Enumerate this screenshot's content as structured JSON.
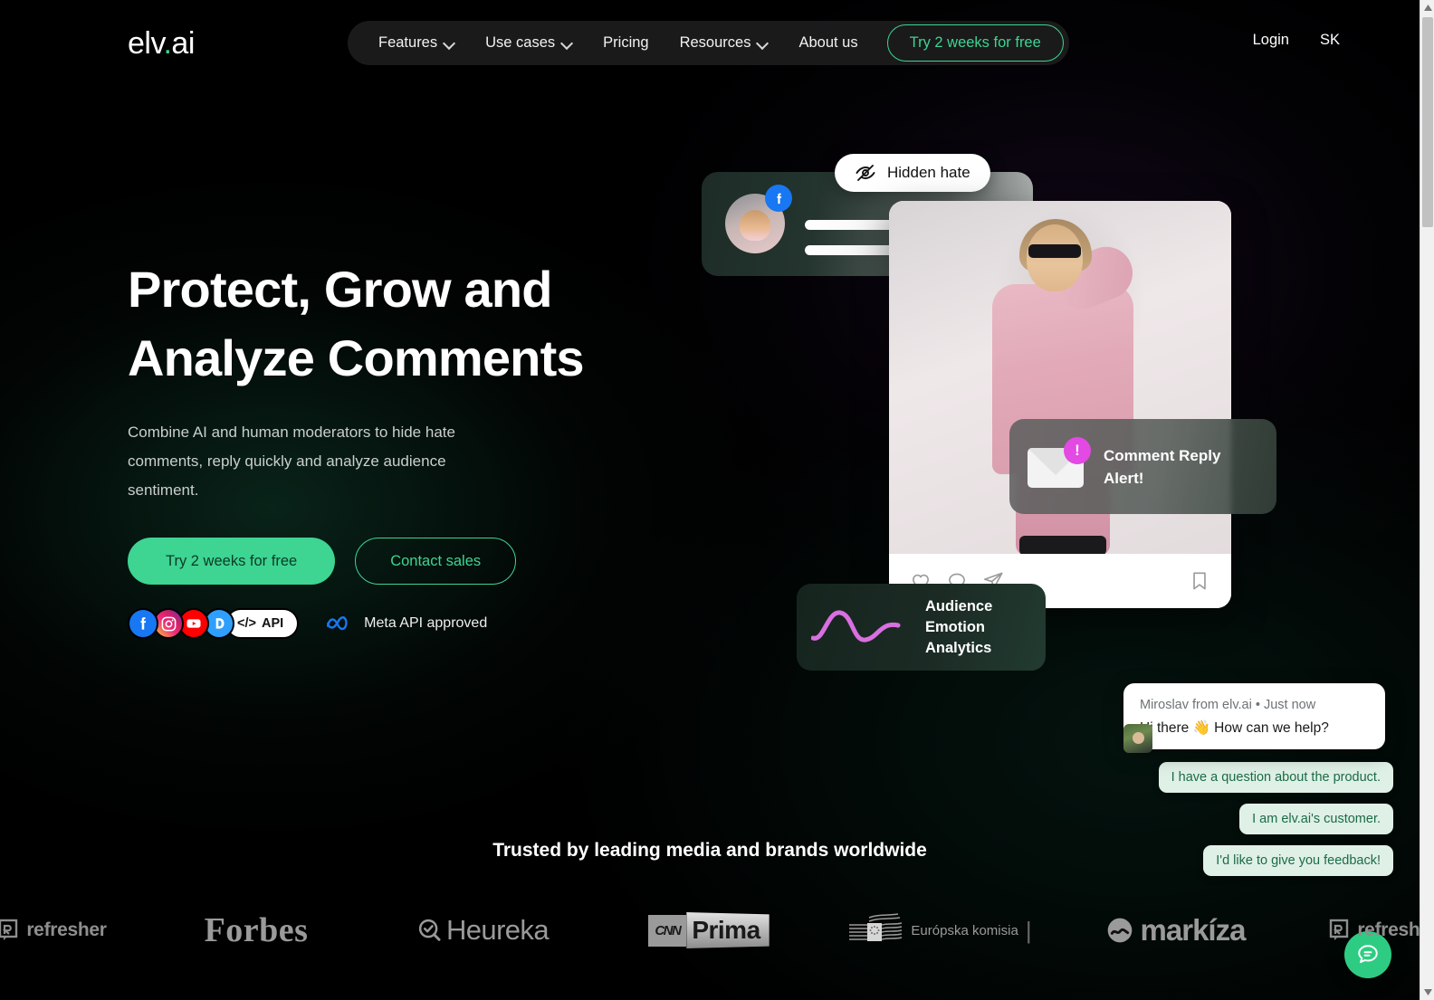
{
  "header": {
    "logo_text": "elv",
    "logo_dot": ".",
    "logo_suffix": "ai",
    "nav": [
      {
        "label": "Features",
        "has_dropdown": true
      },
      {
        "label": "Use cases",
        "has_dropdown": true
      },
      {
        "label": "Pricing",
        "has_dropdown": false
      },
      {
        "label": "Resources",
        "has_dropdown": true
      },
      {
        "label": "About us",
        "has_dropdown": false
      }
    ],
    "cta_label": "Try 2 weeks for free",
    "login_label": "Login",
    "language_label": "SK"
  },
  "hero": {
    "title_line1": "Protect, Grow and",
    "title_line2": "Analyze Comments",
    "subtitle": "Combine AI and human moderators to hide hate comments, reply quickly and analyze audience sentiment.",
    "primary_cta": "Try 2 weeks for free",
    "secondary_cta": "Contact sales",
    "social_icons": [
      {
        "name": "facebook-icon",
        "glyph": "f"
      },
      {
        "name": "instagram-icon",
        "glyph": ""
      },
      {
        "name": "youtube-icon",
        "glyph": ""
      },
      {
        "name": "disqus-icon",
        "glyph": "D"
      }
    ],
    "api_pill_label": "API",
    "api_pill_glyph": "</>",
    "meta_label": "Meta API approved"
  },
  "visual": {
    "hidden_hate_label": "Hidden hate",
    "alert_line1": "Comment Reply",
    "alert_line2": "Alert!",
    "alert_badge": "!",
    "analytics_line1": "Audience Emotion",
    "analytics_line2": "Analytics",
    "ig_actions": [
      "like-icon",
      "comment-icon",
      "share-icon",
      "bookmark-icon"
    ]
  },
  "chat": {
    "meta": "Miroslav from elv.ai • Just now",
    "message": "Hi there 👋 How can we help?",
    "quick_replies": [
      "I have a question about the product.",
      "I am elv.ai's customer.",
      "I'd like to give you feedback!"
    ]
  },
  "trusted": {
    "title": "Trusted by leading media and brands worldwide",
    "logos": [
      "refresher",
      "Forbes",
      "Heureka",
      "CNN Prima",
      "Európska komisia",
      "markíza",
      "refresher"
    ]
  },
  "colors": {
    "accent_green": "#3ED492",
    "fab_green": "#2ECC82",
    "chip_bg": "#dff0e6",
    "chip_text": "#1c6b46",
    "badge_magenta": "#e349e3",
    "wave_pink": "#d96fe0"
  }
}
